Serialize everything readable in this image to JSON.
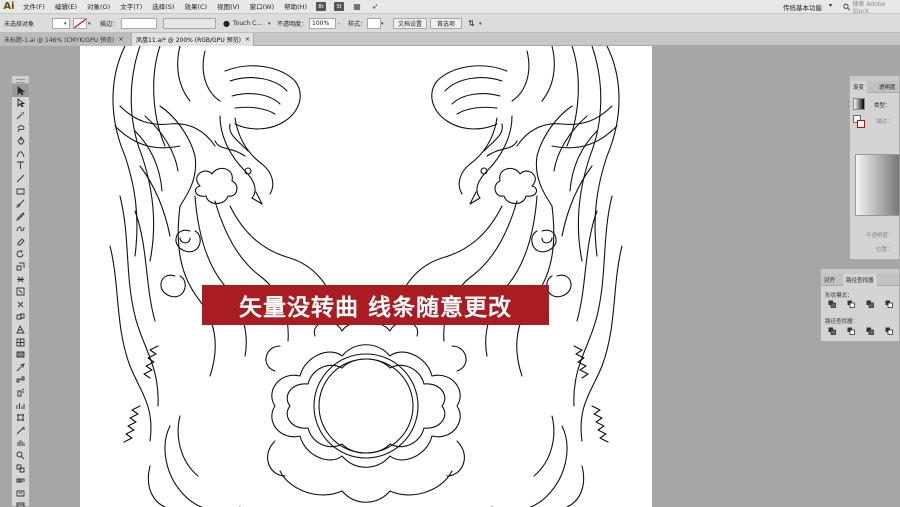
{
  "app": {
    "logo": "Ai",
    "menu": [
      "文件(F)",
      "编辑(E)",
      "对象(O)",
      "文字(T)",
      "选择(S)",
      "效果(C)",
      "视图(V)",
      "窗口(W)",
      "帮助(H)"
    ],
    "menubar_icons": [
      "Br",
      "St"
    ],
    "workspace": "传统基本功能",
    "search_placeholder": "搜索 Adobe Stock"
  },
  "control_bar": {
    "selection_status": "未选择对象",
    "stroke_label": "描边：",
    "brush_label": "Touch C...",
    "opacity_label": "不透明度：",
    "opacity_value": "100%",
    "style_label": "样式：",
    "doc_setup_button": "文档设置",
    "preferences_button": "首选项"
  },
  "tabs": [
    {
      "label": "未标题-1.ai @ 146% (CMYK/GPU 预览)",
      "active": false
    },
    {
      "label": "凤凰11.ai* @ 200% (RGB/GPU 预览)",
      "active": true
    }
  ],
  "tools": [
    "selection",
    "direct-selection",
    "magic-wand",
    "lasso",
    "pen",
    "curvature",
    "type",
    "line",
    "rectangle",
    "paintbrush",
    "pencil",
    "shaper",
    "eraser",
    "rotate",
    "scale",
    "width",
    "free-transform",
    "puppet-warp",
    "shape-builder",
    "perspective-grid",
    "mesh",
    "gradient",
    "eyedropper",
    "blend",
    "symbol-sprayer",
    "column-graph",
    "artboard",
    "slice",
    "hand",
    "zoom",
    "fill-stroke",
    "color-modes",
    "draw-modes",
    "screen-mode"
  ],
  "banner": {
    "text": "矢量没转曲 线条随意更改",
    "color": "#a91d22"
  },
  "gradient_panel": {
    "tabs": [
      "渐变",
      "透明度"
    ],
    "type_label": "类型：",
    "stroke_label": "描边：",
    "opacity_label": "不透明度：",
    "position_label": "位置："
  },
  "pathfinder_panel": {
    "tabs": [
      "对齐",
      "路径查找器"
    ],
    "shape_modes_label": "形状模式：",
    "pathfinders_label": "路径查找器："
  }
}
